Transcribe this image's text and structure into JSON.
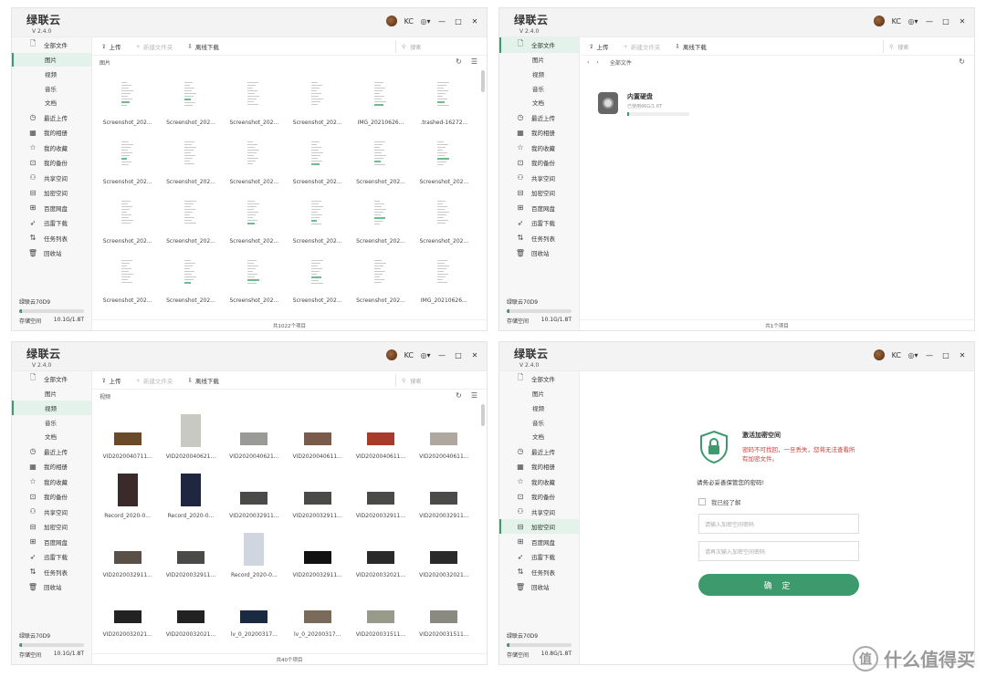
{
  "app": {
    "name": "绿联云",
    "version": "V 2.4.0",
    "user": "KC"
  },
  "window_controls": {
    "settings": "◎▾",
    "minimize": "—",
    "maximize": "□",
    "close": "✕"
  },
  "sidebar": {
    "items": [
      {
        "label": "全部文件",
        "icon": "file-icon",
        "glyph": "🗋",
        "sub": false
      },
      {
        "label": "图片",
        "icon": "",
        "glyph": "",
        "sub": true
      },
      {
        "label": "视频",
        "icon": "",
        "glyph": "",
        "sub": true
      },
      {
        "label": "音乐",
        "icon": "",
        "glyph": "",
        "sub": true
      },
      {
        "label": "文档",
        "icon": "",
        "glyph": "",
        "sub": true
      },
      {
        "label": "最近上传",
        "icon": "clock-icon",
        "glyph": "◷",
        "sub": false
      },
      {
        "label": "我的相册",
        "icon": "grid-icon",
        "glyph": "▦",
        "sub": false
      },
      {
        "label": "我的收藏",
        "icon": "star-icon",
        "glyph": "☆",
        "sub": false
      },
      {
        "label": "我的备份",
        "icon": "backup-icon",
        "glyph": "⊡",
        "sub": false
      },
      {
        "label": "共享空间",
        "icon": "users-icon",
        "glyph": "⚇",
        "sub": false
      },
      {
        "label": "加密空间",
        "icon": "lock-icon",
        "glyph": "⊟",
        "sub": false
      },
      {
        "label": "百度网盘",
        "icon": "cloud-drive-icon",
        "glyph": "⊞",
        "sub": false
      },
      {
        "label": "迅雷下载",
        "icon": "thunder-icon",
        "glyph": "➶",
        "sub": false
      },
      {
        "label": "任务列表",
        "icon": "sort-icon",
        "glyph": "⇅",
        "sub": false
      },
      {
        "label": "回收站",
        "icon": "trash-icon",
        "glyph": "🗑",
        "sub": false
      }
    ],
    "device": {
      "name": "绿联云70D9",
      "storage_label": "存储空间",
      "storage_used": 0.04
    }
  },
  "toolbar": {
    "upload": "上传",
    "new_folder": "新建文件夹",
    "offline_download": "离线下载",
    "search_placeholder": "搜索"
  },
  "windows": [
    {
      "active": "图片",
      "mode": "grid",
      "storage_text": "10.1G/1.8T",
      "path": "图片",
      "footer": "共1022个项目",
      "files": [
        {
          "name": "Screenshot_202...",
          "kind": "doc"
        },
        {
          "name": "Screenshot_202...",
          "kind": "doc"
        },
        {
          "name": "Screenshot_202...",
          "kind": "doc"
        },
        {
          "name": "Screenshot_202...",
          "kind": "doc"
        },
        {
          "name": "IMG_20210626...",
          "kind": "doc"
        },
        {
          "name": ".trashed-16272...",
          "kind": "doc"
        },
        {
          "name": "Screenshot_202...",
          "kind": "doc"
        },
        {
          "name": "Screenshot_202...",
          "kind": "doc"
        },
        {
          "name": "Screenshot_202...",
          "kind": "doc"
        },
        {
          "name": "Screenshot_202...",
          "kind": "doc"
        },
        {
          "name": "Screenshot_202...",
          "kind": "doc"
        },
        {
          "name": "Screenshot_202...",
          "kind": "doc"
        },
        {
          "name": "Screenshot_202...",
          "kind": "doc"
        },
        {
          "name": "Screenshot_202...",
          "kind": "doc"
        },
        {
          "name": "Screenshot_202...",
          "kind": "doc"
        },
        {
          "name": "Screenshot_202...",
          "kind": "doc"
        },
        {
          "name": "Screenshot_202...",
          "kind": "doc"
        },
        {
          "name": "Screenshot_202...",
          "kind": "doc"
        },
        {
          "name": "Screenshot_202...",
          "kind": "doc"
        },
        {
          "name": "Screenshot_202...",
          "kind": "doc"
        },
        {
          "name": "Screenshot_202...",
          "kind": "doc"
        },
        {
          "name": "Screenshot_202...",
          "kind": "doc"
        },
        {
          "name": "Screenshot_202...",
          "kind": "doc"
        },
        {
          "name": "IMG_20210626...",
          "kind": "doc"
        }
      ]
    },
    {
      "active": "全部文件",
      "mode": "disk",
      "storage_text": "10.1G/1.8T",
      "path": "全部文件",
      "nav_back": "‹",
      "nav_forward": "›",
      "disk_name": "内置硬盘",
      "disk_sub": "已使用86G/1.8T",
      "footer": "共1个项目"
    },
    {
      "active": "视频",
      "mode": "grid",
      "storage_text": "10.1G/1.8T",
      "path": "视频",
      "footer": "共40个项目",
      "files": [
        {
          "name": "VID2020040711...",
          "kind": "vid",
          "color": "#6b4a2a"
        },
        {
          "name": "VID2020040621...",
          "kind": "vid",
          "color": "#c9c9c4"
        },
        {
          "name": "VID2020040621...",
          "kind": "vid",
          "color": "#9a9a96"
        },
        {
          "name": "VID2020040611...",
          "kind": "vid",
          "color": "#7a5a4a"
        },
        {
          "name": "VID2020040611...",
          "kind": "vid",
          "color": "#a83c2a"
        },
        {
          "name": "VID2020040611...",
          "kind": "vid",
          "color": "#b0a8a0"
        },
        {
          "name": "Record_2020-0...",
          "kind": "vid",
          "color": "#3a2a2a"
        },
        {
          "name": "Record_2020-0...",
          "kind": "vid",
          "color": "#1e2640"
        },
        {
          "name": "VID2020032911...",
          "kind": "vid",
          "color": "#4a4a48"
        },
        {
          "name": "VID2020032911...",
          "kind": "vid",
          "color": "#4a4a48"
        },
        {
          "name": "VID2020032911...",
          "kind": "vid",
          "color": "#4a4a48"
        },
        {
          "name": "VID2020032911...",
          "kind": "vid",
          "color": "#4a4a48"
        },
        {
          "name": "VID2020032911...",
          "kind": "vid",
          "color": "#5a5048"
        },
        {
          "name": "VID2020032911...",
          "kind": "vid",
          "color": "#4a4a48"
        },
        {
          "name": "Record_2020-0...",
          "kind": "vid",
          "color": "#cfd6df"
        },
        {
          "name": "VID2020032911...",
          "kind": "vid",
          "color": "#111111"
        },
        {
          "name": "VID2020032021...",
          "kind": "vid",
          "color": "#2a2a2a"
        },
        {
          "name": "VID2020032021...",
          "kind": "vid",
          "color": "#2a2a2a"
        },
        {
          "name": "VID2020032021...",
          "kind": "vid",
          "color": "#222222"
        },
        {
          "name": "VID2020032021...",
          "kind": "vid",
          "color": "#222222"
        },
        {
          "name": "lv_0_20200317...",
          "kind": "vid",
          "color": "#1a2a40"
        },
        {
          "name": "lv_0_20200317...",
          "kind": "vid",
          "color": "#7a6a5a"
        },
        {
          "name": "VID2020031511...",
          "kind": "vid",
          "color": "#9a9a8a"
        },
        {
          "name": "VID2020031511...",
          "kind": "vid",
          "color": "#8a8a80"
        }
      ]
    },
    {
      "active": "加密空间",
      "mode": "crypt",
      "storage_text": "10.8G/1.8T",
      "crypt": {
        "title": "激活加密空间",
        "warning": "密码不可找回，一旦丢失，您将无法查看所有加密文件。",
        "notice": "请务必妥善保管您的密码!",
        "checkbox": "我已经了解",
        "input1": "请输入加密空间密码",
        "input2": "请再次输入加密空间密码",
        "confirm": "确 定"
      }
    }
  ],
  "watermark": {
    "text": "什么值得买",
    "glyph": "值"
  }
}
